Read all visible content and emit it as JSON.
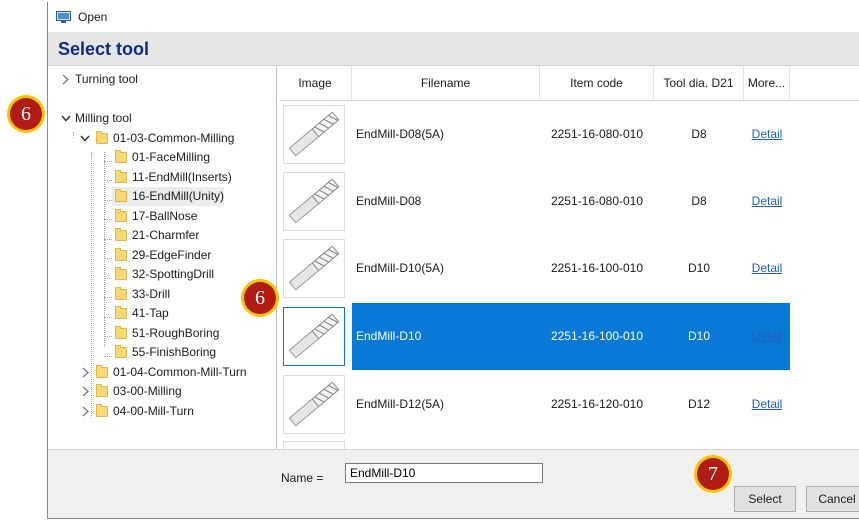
{
  "window": {
    "title": "Open",
    "header": "Select tool"
  },
  "tree": {
    "items": [
      {
        "label": "Turning tool"
      },
      {
        "label": "Milling tool"
      },
      {
        "label": "01-03-Common-Milling"
      },
      {
        "label": "01-FaceMilling"
      },
      {
        "label": "11-EndMill(Inserts)"
      },
      {
        "label": "16-EndMill(Unity)"
      },
      {
        "label": "17-BallNose"
      },
      {
        "label": "21-Charmfer"
      },
      {
        "label": "29-EdgeFinder"
      },
      {
        "label": "32-SpottingDrill"
      },
      {
        "label": "33-Drill"
      },
      {
        "label": "41-Tap"
      },
      {
        "label": "51-RoughBoring"
      },
      {
        "label": "55-FinishBoring"
      },
      {
        "label": "01-04-Common-Mill-Turn"
      },
      {
        "label": "03-00-Milling"
      },
      {
        "label": "04-00-Mill-Turn"
      }
    ]
  },
  "table": {
    "headers": [
      "Image",
      "Filename",
      "Item code",
      "Tool dia. D21",
      "More..."
    ],
    "rows": [
      {
        "filename": "EndMill-D08(5A)",
        "item_code": "2251-16-080-010",
        "dia": "D8",
        "more": "Detail"
      },
      {
        "filename": "EndMill-D08",
        "item_code": "2251-16-080-010",
        "dia": "D8",
        "more": "Detail"
      },
      {
        "filename": "EndMill-D10(5A)",
        "item_code": "2251-16-100-010",
        "dia": "D10",
        "more": "Detail"
      },
      {
        "filename": "EndMill-D10",
        "item_code": "2251-16-100-010",
        "dia": "D10",
        "more": "Detail"
      },
      {
        "filename": "EndMill-D12(5A)",
        "item_code": "2251-16-120-010",
        "dia": "D12",
        "more": "Detail"
      }
    ]
  },
  "bottom": {
    "name_label": "Name =",
    "name_value": "EndMill-D10",
    "select_label": "Select",
    "cancel_label": "Cancel"
  },
  "markers": {
    "tree": "6",
    "table": "6",
    "select": "7"
  },
  "colors": {
    "header_title": "#0d2c84",
    "selection": "#0a78d7",
    "link": "#1f5fbf",
    "marker": "#b01c14",
    "marker_ring": "#f2c300"
  }
}
